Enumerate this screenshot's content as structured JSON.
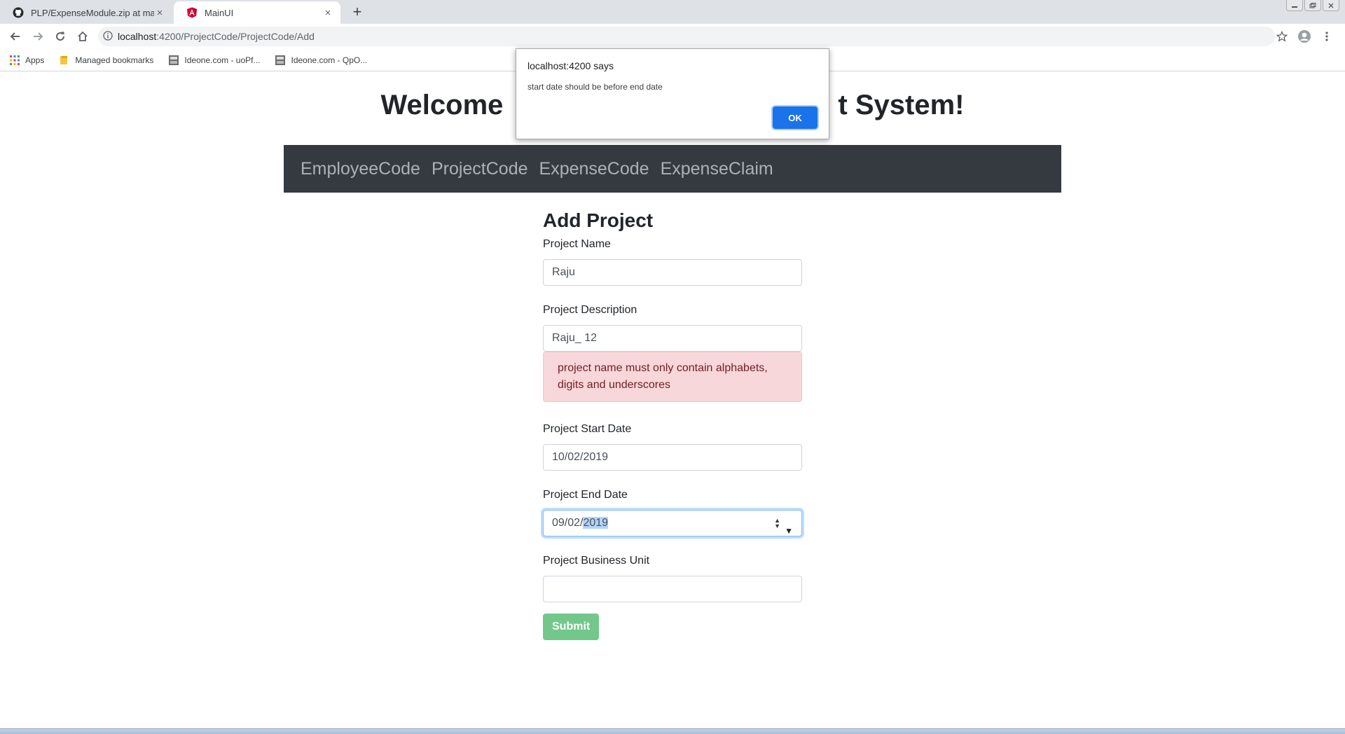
{
  "browser": {
    "tabs": [
      {
        "title": "PLP/ExpenseModule.zip at maste",
        "icon": "github-icon",
        "close": "×"
      },
      {
        "title": "MainUI",
        "icon": "angular-icon",
        "close": "×"
      }
    ],
    "new_tab": "+",
    "url_host": "localhost",
    "url_path": ":4200/ProjectCode/ProjectCode/Add",
    "bookmarks": [
      {
        "label": "Apps",
        "icon": "apps-grid-icon"
      },
      {
        "label": "Managed bookmarks",
        "icon": "folder-icon"
      },
      {
        "label": "Ideone.com - uoPf...",
        "icon": "ideone-icon"
      },
      {
        "label": "Ideone.com - QpO...",
        "icon": "ideone-icon"
      }
    ]
  },
  "page": {
    "welcome_left": "Welcome",
    "welcome_right": "t System!",
    "nav": [
      "EmployeeCode",
      "ProjectCode",
      "ExpenseCode",
      "ExpenseClaim"
    ],
    "form": {
      "title": "Add Project",
      "project_name_label": "Project Name",
      "project_name_value": "Raju",
      "project_desc_label": "Project Description",
      "project_desc_value": "Raju_ 12",
      "desc_error": "project name must only contain alphabets, digits and underscores",
      "start_label": "Project Start Date",
      "start_value": "10/02/2019",
      "end_label": "Project End Date",
      "end_value_prefix": "09/02/",
      "end_value_selected": "2019",
      "bu_label": "Project Business Unit",
      "bu_value": "",
      "submit": "Submit"
    }
  },
  "dialog": {
    "title": "localhost:4200 says",
    "message": "start date should be before end date",
    "ok": "OK"
  },
  "colors": {
    "navbar": "#343a40",
    "alert_bg": "#f8d7da",
    "submit": "#72c88b",
    "dialog_ok": "#1a73e8"
  }
}
